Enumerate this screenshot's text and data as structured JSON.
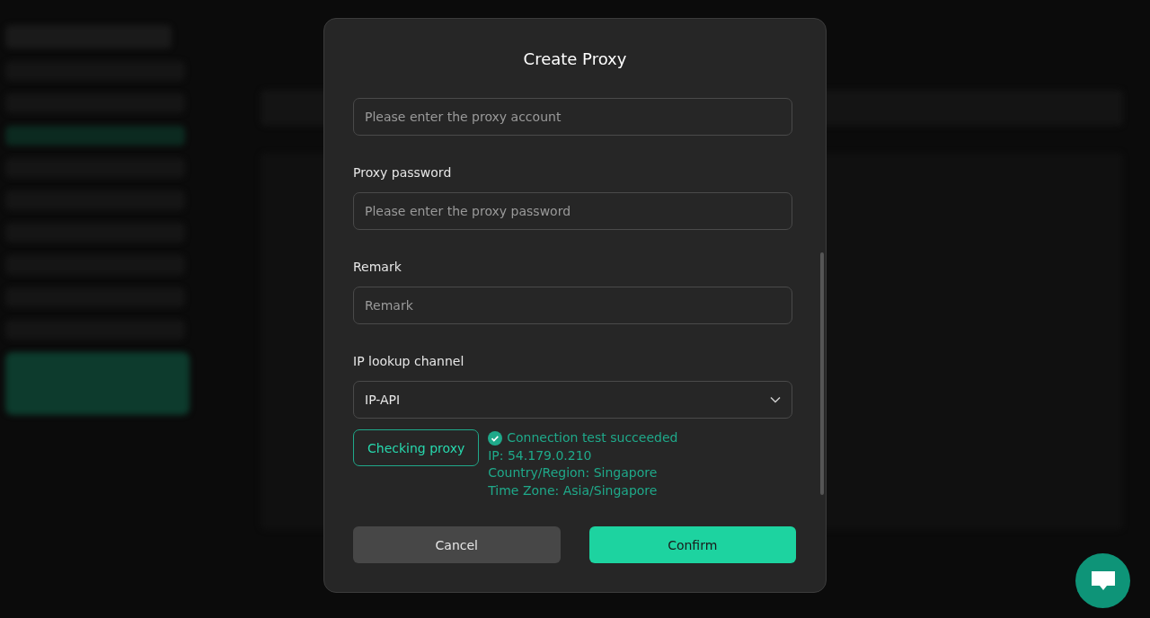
{
  "dialog": {
    "title": "Create Proxy",
    "fields": [
      {
        "kind": "input",
        "placeholder": "Please enter the proxy account"
      },
      {
        "kind": "input",
        "label": "Proxy password",
        "placeholder": "Please enter the proxy password"
      },
      {
        "kind": "input",
        "label": "Remark",
        "placeholder": "Remark"
      },
      {
        "kind": "select",
        "label": "IP lookup channel",
        "value": "IP-API"
      }
    ],
    "check": {
      "button": "Checking proxy",
      "success": true,
      "status": "Connection test succeeded",
      "details": [
        "IP: 54.179.0.210",
        "Country/Region: Singapore",
        "Time Zone: Asia/Singapore"
      ]
    },
    "buttons": [
      {
        "kind": "secondary",
        "label": "Cancel"
      },
      {
        "kind": "primary",
        "label": "Confirm"
      }
    ]
  }
}
